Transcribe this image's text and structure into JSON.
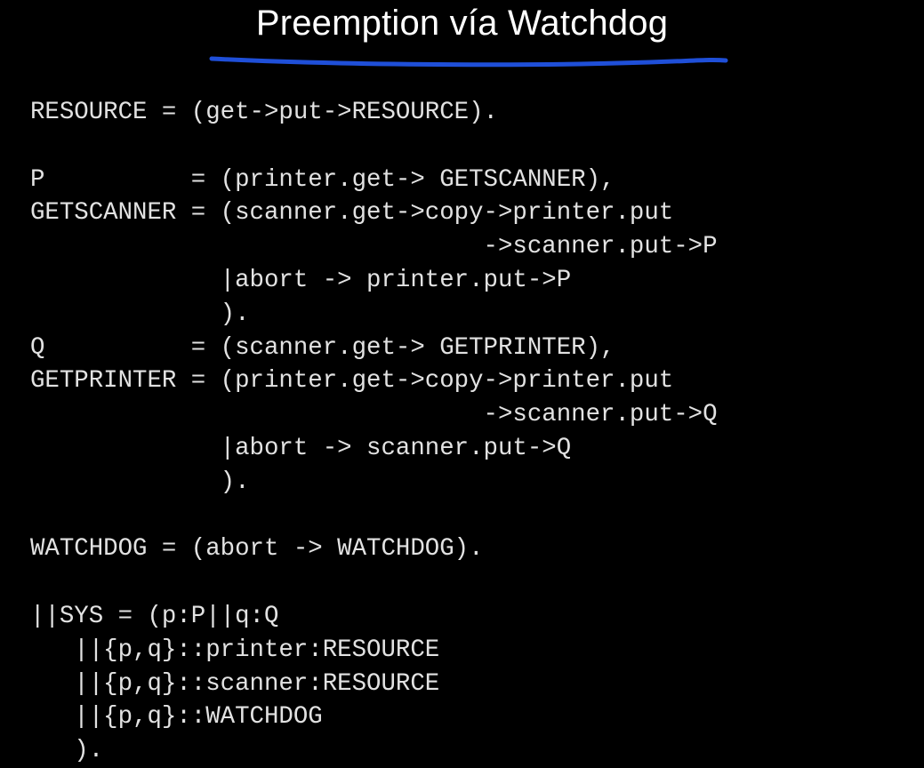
{
  "slide": {
    "title": "Preemption vía Watchdog",
    "colors": {
      "background": "#000000",
      "text": "#e2e2e2",
      "title": "#ffffff",
      "underline": "#1f4fd8"
    },
    "code_lines": [
      "RESOURCE = (get->put->RESOURCE).",
      "",
      "P          = (printer.get-> GETSCANNER),",
      "GETSCANNER = (scanner.get->copy->printer.put",
      "                               ->scanner.put->P",
      "             |abort -> printer.put->P",
      "             ).",
      "Q          = (scanner.get-> GETPRINTER),",
      "GETPRINTER = (printer.get->copy->printer.put",
      "                               ->scanner.put->Q",
      "             |abort -> scanner.put->Q",
      "             ).",
      "",
      "WATCHDOG = (abort -> WATCHDOG).",
      "",
      "||SYS = (p:P||q:Q",
      "   ||{p,q}::printer:RESOURCE",
      "   ||{p,q}::scanner:RESOURCE",
      "   ||{p,q}::WATCHDOG",
      "   )."
    ]
  }
}
